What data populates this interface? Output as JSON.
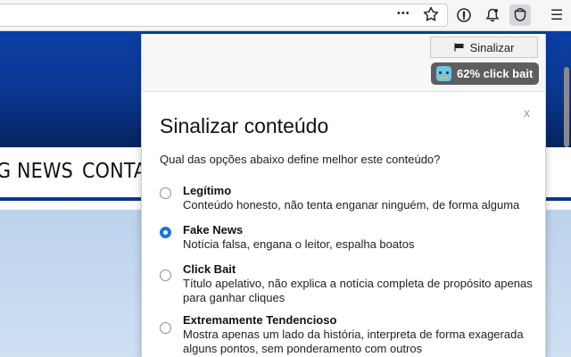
{
  "toolbar": {
    "more_icon_text": "•••",
    "menu_icon_text": "☰"
  },
  "site": {
    "nav_items": [
      "G NEWS",
      "CONTAC"
    ]
  },
  "popup": {
    "flag_button_label": "Sinalizar",
    "badge_label": "62% click bait",
    "close_label": "x",
    "title": "Sinalizar conteúdo",
    "question": "Qual das opções abaixo define melhor este conteúdo?",
    "options": [
      {
        "title": "Legítimo",
        "description": "Conteúdo honesto, não tenta enganar ninguém, de forma alguma",
        "selected": false
      },
      {
        "title": "Fake News",
        "description": "Notícia falsa, engana o leitor, espalha boatos",
        "selected": true
      },
      {
        "title": "Click Bait",
        "description": "Título apelativo, não explica a notícia completa de propósito apenas para ganhar cliques",
        "selected": false
      },
      {
        "title": "Extremamente Tendencioso",
        "description": "Mostra apenas um lado da história, interpreta de forma exagerada alguns pontos, sem ponderamento com outros",
        "selected": false
      }
    ]
  },
  "colors": {
    "site_blue": "#0a3790",
    "radio_selected": "#1a73e8",
    "badge_bg": "#5e5e60"
  },
  "icons": [
    "more-icon",
    "star-icon",
    "password-manager-icon",
    "notification-bell-icon",
    "extension-icon",
    "menu-icon",
    "flag-icon",
    "robot-icon",
    "search-icon"
  ]
}
